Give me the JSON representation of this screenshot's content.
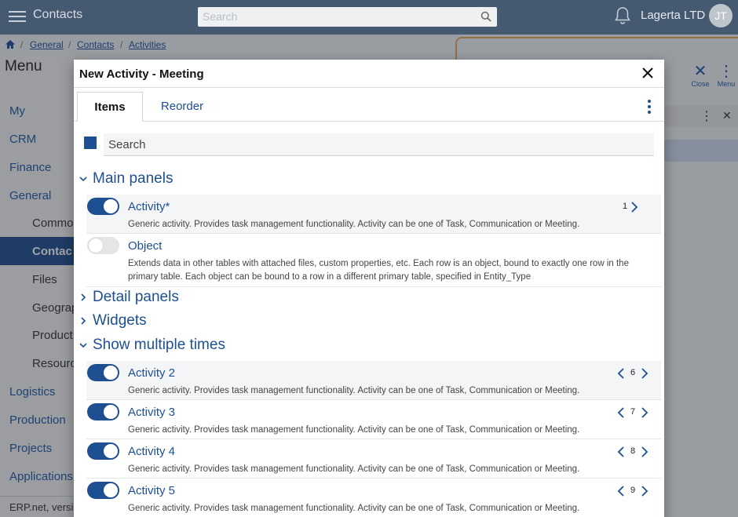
{
  "topbar": {
    "app_title": "Contacts",
    "search_placeholder": "Search",
    "company": "Lagerta LTD",
    "avatar_initials": "JT"
  },
  "breadcrumb": [
    "General",
    "Contacts",
    "Activities"
  ],
  "sidebar": {
    "title": "Menu",
    "items": [
      "My",
      "CRM",
      "Finance",
      "General",
      "Commo",
      "Contac",
      "Files",
      "Geograp",
      "Product",
      "Resourc",
      "Logistics",
      "Production",
      "Projects",
      "Applications"
    ],
    "footer": "ERP.net, versi"
  },
  "right_panel": {
    "close_label": "Close",
    "menu_label": "Menu"
  },
  "dialog": {
    "title": "New Activity - Meeting",
    "tabs": [
      "Items",
      "Reorder"
    ],
    "active_tab": "Items",
    "search_placeholder": "Search",
    "sections": {
      "main": "Main panels",
      "detail": "Detail panels",
      "widgets": "Widgets",
      "multiple": "Show multiple times"
    },
    "main_panels": [
      {
        "title": "Activity*",
        "description": "Generic activity. Provides task management functionality. Activity can be one of Task, Communication or Meeting.",
        "enabled": true,
        "order": "1"
      },
      {
        "title": "Object",
        "description": "Extends data in other tables with attached files, custom properties, etc. Each row is an object, bound to exactly one row in the primary table. Each object can be bound to a row in a different primary table, specified in Entity_Type",
        "enabled": false,
        "order": ""
      }
    ],
    "multiple_items": [
      {
        "title": "Activity 2",
        "description": "Generic activity. Provides task management functionality. Activity can be one of Task, Communication or Meeting.",
        "enabled": true,
        "order": "6"
      },
      {
        "title": "Activity 3",
        "description": "Generic activity. Provides task management functionality. Activity can be one of Task, Communication or Meeting.",
        "enabled": true,
        "order": "7"
      },
      {
        "title": "Activity 4",
        "description": "Generic activity. Provides task management functionality. Activity can be one of Task, Communication or Meeting.",
        "enabled": true,
        "order": "8"
      },
      {
        "title": "Activity 5",
        "description": "Generic activity. Provides task management functionality. Activity can be one of Task, Communication or Meeting.",
        "enabled": true,
        "order": "9"
      }
    ]
  },
  "colors": {
    "topbar": "#455a70",
    "accent": "#1e4f90",
    "overlay": "rgba(30,36,44,0.42)"
  }
}
